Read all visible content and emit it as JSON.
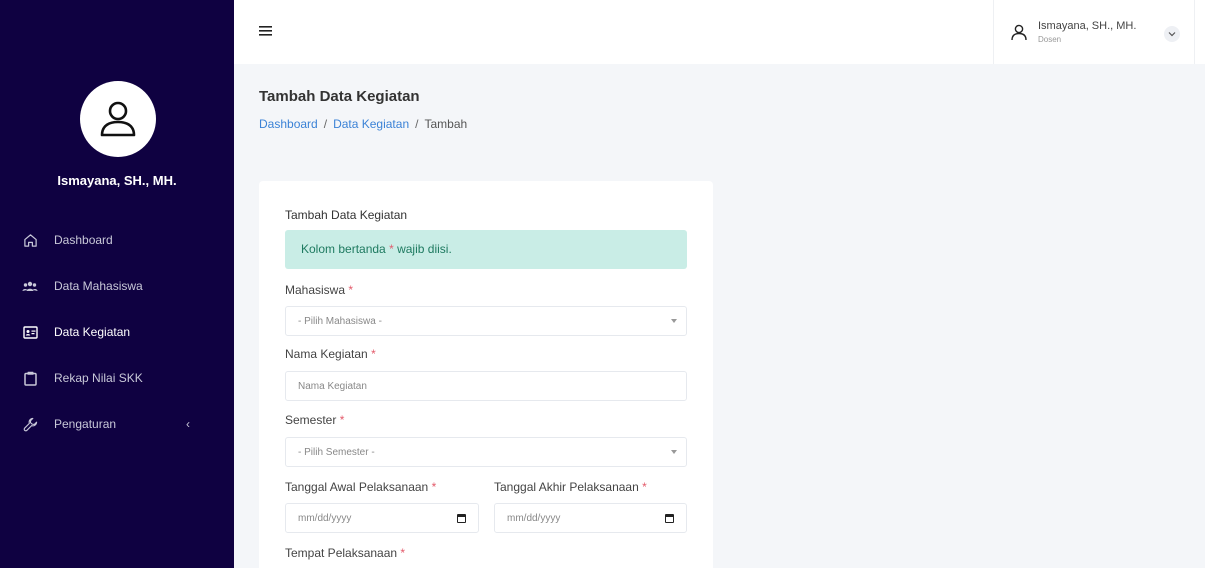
{
  "sidebar": {
    "user_name": "Ismayana, SH., MH.",
    "items": [
      {
        "label": "Dashboard",
        "icon": "home-icon"
      },
      {
        "label": "Data Mahasiswa",
        "icon": "users-icon"
      },
      {
        "label": "Data Kegiatan",
        "icon": "id-card-icon",
        "active": true
      },
      {
        "label": "Rekap Nilai SKK",
        "icon": "clipboard-icon"
      },
      {
        "label": "Pengaturan",
        "icon": "wrench-icon",
        "chevron": "‹"
      }
    ]
  },
  "topbar": {
    "user_name": "Ismayana, SH., MH.",
    "user_role": "Dosen"
  },
  "page": {
    "title": "Tambah Data Kegiatan",
    "breadcrumb": [
      "Dashboard",
      "Data Kegiatan",
      "Tambah"
    ]
  },
  "form": {
    "card_title": "Tambah Data Kegiatan",
    "alert_prefix": "Kolom bertanda",
    "alert_star": "*",
    "alert_suffix": "wajib diisi.",
    "fields": {
      "mahasiswa": {
        "label": "Mahasiswa",
        "placeholder": "- Pilih Mahasiswa -"
      },
      "nama_kegiatan": {
        "label": "Nama Kegiatan",
        "placeholder": "Nama Kegiatan"
      },
      "semester": {
        "label": "Semester",
        "placeholder": "- Pilih Semester -"
      },
      "tanggal_awal": {
        "label": "Tanggal Awal Pelaksanaan",
        "placeholder": "mm/dd/yyyy"
      },
      "tanggal_akhir": {
        "label": "Tanggal Akhir Pelaksanaan",
        "placeholder": "mm/dd/yyyy"
      },
      "tempat": {
        "label": "Tempat Pelaksanaan"
      }
    },
    "required_mark": "*"
  },
  "colors": {
    "sidebar_bg": "#0f0141",
    "link": "#3b82d6",
    "alert_bg": "#c9ede6",
    "required": "#e35a6a"
  }
}
